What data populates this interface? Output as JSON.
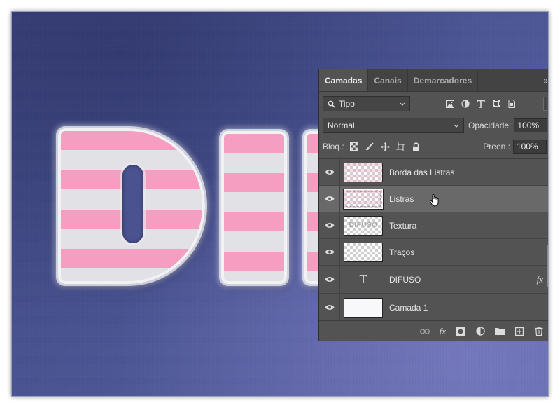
{
  "panel": {
    "tabs": [
      {
        "label": "Camadas",
        "active": true
      },
      {
        "label": "Canais",
        "active": false
      },
      {
        "label": "Demarcadores",
        "active": false
      }
    ],
    "menu_glyph": "»"
  },
  "filter": {
    "kind_label": "Tipo",
    "icons": [
      "image-filter-icon",
      "adjustment-filter-icon",
      "type-filter-icon",
      "shape-filter-icon",
      "smart-object-filter-icon"
    ]
  },
  "blend": {
    "mode": "Normal",
    "opacity_label": "Opacidade:",
    "opacity_value": "100%"
  },
  "lock": {
    "label": "Bloq.:",
    "icons": [
      "lock-transparent-pixels-icon",
      "lock-image-pixels-icon",
      "lock-position-icon",
      "lock-artboard-icon",
      "lock-all-icon"
    ],
    "fill_label": "Preen.:",
    "fill_value": "100%"
  },
  "layers": [
    {
      "name": "Borda das Listras",
      "kind": "pixel",
      "visible": true,
      "selected": false
    },
    {
      "name": "Listras",
      "kind": "pixel",
      "visible": true,
      "selected": true
    },
    {
      "name": "Textura",
      "kind": "pixel",
      "visible": true,
      "selected": false,
      "thumb_text": "DIFUSO"
    },
    {
      "name": "Traços",
      "kind": "pixel",
      "visible": true,
      "selected": false
    },
    {
      "name": "DIFUSO",
      "kind": "type",
      "visible": true,
      "selected": false,
      "type_glyph": "T",
      "fx": "fx"
    },
    {
      "name": "Camada 1",
      "kind": "solid",
      "visible": true,
      "selected": false
    }
  ],
  "footer": {
    "fx_label": "fx",
    "icons": [
      "link-layers-icon",
      "add-layer-style-icon",
      "add-mask-icon",
      "new-adjustment-layer-icon",
      "new-group-icon",
      "new-layer-icon",
      "delete-layer-icon"
    ]
  },
  "colors": {
    "panel_bg": "#535353",
    "selected_row": "#696969",
    "stripe_pink": "#f59ec2",
    "stripe_white": "#e2e2e6",
    "canvas_blue": "#4a5492"
  }
}
